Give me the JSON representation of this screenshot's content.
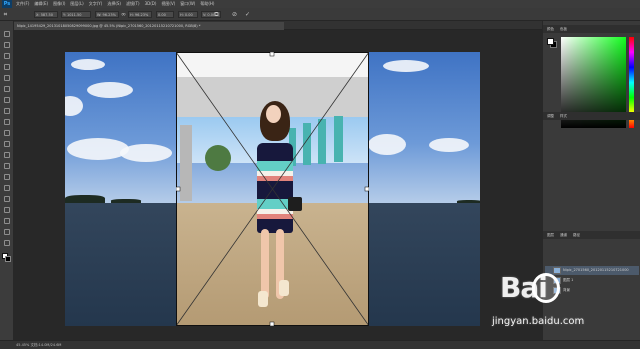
{
  "app": {
    "logo": "Ps"
  },
  "menu": [
    "文件(F)",
    "编辑(E)",
    "图像(I)",
    "图层(L)",
    "文字(Y)",
    "选择(S)",
    "滤镜(T)",
    "3D(D)",
    "视图(V)",
    "窗口(W)",
    "帮助(H)"
  ],
  "options": {
    "x_label": "X: 587.50",
    "y_label": "Y: 1011.50",
    "w_label": "W: 96.23%",
    "h_label": "H: 96.23%",
    "angle_label": "0.00",
    "h_skew": "H: 0.00",
    "v_skew": "V: 0.00"
  },
  "document": {
    "tab_title": "Nipic_14195429_20131018050829099000.jpg @ 45.5% (Nipic_2701560_20120115210721000, RGB/8) *"
  },
  "right_panel": {
    "top_tabs": [
      "颜色",
      "色板"
    ],
    "mid_tabs": [
      "调整",
      "样式"
    ],
    "layers_tabs": [
      "图层",
      "通道",
      "路径"
    ],
    "layers": [
      "Nipic_2701560_20120115210721000",
      "图层 1",
      "背景"
    ]
  },
  "status": {
    "text": "45.45%    文档:14.0M/24.6M"
  },
  "watermark": {
    "logo": "Bai",
    "url": "jingyan.baidu.com"
  },
  "colors": {
    "accent": "#31a8ff",
    "panel": "#3c3c3c",
    "canvas": "#282828"
  }
}
